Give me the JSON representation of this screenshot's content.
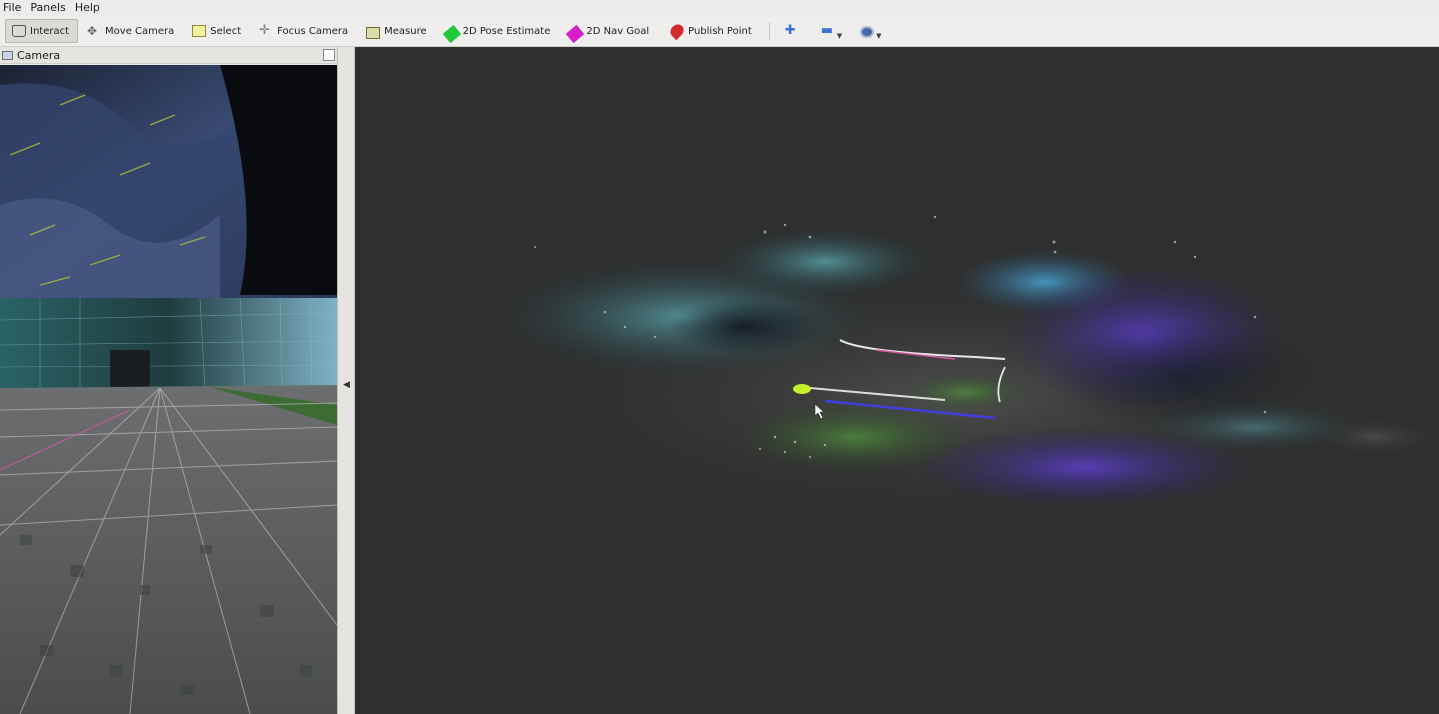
{
  "menu": {
    "file": "File",
    "panels": "Panels",
    "help": "Help"
  },
  "toolbar": {
    "interact": "Interact",
    "move_camera": "Move Camera",
    "select": "Select",
    "focus_camera": "Focus Camera",
    "measure": "Measure",
    "pose_estimate": "2D Pose Estimate",
    "nav_goal": "2D Nav Goal",
    "publish_point": "Publish Point"
  },
  "camera_panel": {
    "title": "Camera"
  },
  "colors": {
    "viewport_bg": "#2f2f2f",
    "pose_estimate": "#21c93a",
    "nav_goal": "#d61ec8",
    "path_line": "#3f3fe0",
    "robot_marker": "#c8f02a"
  }
}
